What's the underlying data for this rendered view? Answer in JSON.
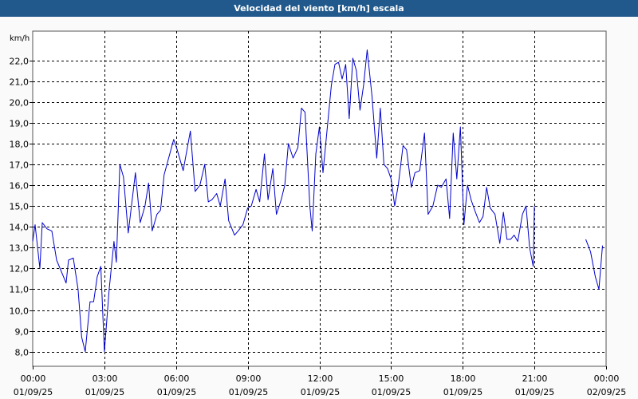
{
  "window": {
    "title": "Velocidad del viento [km/h] escala"
  },
  "colors": {
    "title_bar": "#21598c",
    "line": "#0000cc",
    "grid": "#000000",
    "background": "#fafafa"
  },
  "chart_data": {
    "type": "line",
    "title": "Velocidad del viento [km/h] escala",
    "ylabel": "km/h",
    "ylim": [
      7.3,
      23.4
    ],
    "yticks": [
      8.0,
      9.0,
      10.0,
      11.0,
      12.0,
      13.0,
      14.0,
      15.0,
      16.0,
      17.0,
      18.0,
      19.0,
      20.0,
      21.0,
      22.0
    ],
    "ytick_labels": [
      "8,0",
      "9,0",
      "10,0",
      "11,0",
      "12,0",
      "13,0",
      "14,0",
      "15,0",
      "16,0",
      "17,0",
      "18,0",
      "19,0",
      "20,0",
      "21,0",
      "22,0"
    ],
    "xlim": [
      0,
      24
    ],
    "xticks": [
      {
        "time": "00:00",
        "date": "01/09/25"
      },
      {
        "time": "03:00",
        "date": "01/09/25"
      },
      {
        "time": "06:00",
        "date": "01/09/25"
      },
      {
        "time": "09:00",
        "date": "01/09/25"
      },
      {
        "time": "12:00",
        "date": "01/09/25"
      },
      {
        "time": "15:00",
        "date": "01/09/25"
      },
      {
        "time": "18:00",
        "date": "01/09/25"
      },
      {
        "time": "21:00",
        "date": "01/09/25"
      },
      {
        "time": "00:00",
        "date": "02/09/25"
      }
    ],
    "grid": true,
    "grid_style": "dashed",
    "series": [
      {
        "color": "#0000cc",
        "segments": [
          [
            [
              0.0,
              13.3
            ],
            [
              0.1,
              14.1
            ],
            [
              0.3,
              12.0
            ],
            [
              0.4,
              14.2
            ],
            [
              0.6,
              13.9
            ],
            [
              0.8,
              13.8
            ],
            [
              1.0,
              12.4
            ],
            [
              1.4,
              11.3
            ],
            [
              1.5,
              12.4
            ],
            [
              1.7,
              12.5
            ],
            [
              1.9,
              11.0
            ],
            [
              2.05,
              8.7
            ],
            [
              2.2,
              8.0
            ],
            [
              2.4,
              10.4
            ],
            [
              2.55,
              10.4
            ],
            [
              2.7,
              11.6
            ],
            [
              2.85,
              12.1
            ],
            [
              3.0,
              8.0
            ],
            [
              3.2,
              11.0
            ],
            [
              3.4,
              13.3
            ],
            [
              3.5,
              12.3
            ],
            [
              3.65,
              17.0
            ],
            [
              3.8,
              16.4
            ],
            [
              4.0,
              13.7
            ],
            [
              4.3,
              16.6
            ],
            [
              4.5,
              14.2
            ],
            [
              4.7,
              15.0
            ],
            [
              4.85,
              16.1
            ],
            [
              5.0,
              13.8
            ],
            [
              5.2,
              14.6
            ],
            [
              5.35,
              14.8
            ],
            [
              5.5,
              16.5
            ],
            [
              5.9,
              18.2
            ],
            [
              6.05,
              17.7
            ],
            [
              6.3,
              16.7
            ],
            [
              6.6,
              18.6
            ],
            [
              6.8,
              15.7
            ],
            [
              7.0,
              16.0
            ],
            [
              7.2,
              17.0
            ],
            [
              7.35,
              15.2
            ],
            [
              7.5,
              15.3
            ],
            [
              7.7,
              15.6
            ],
            [
              7.85,
              15.0
            ],
            [
              8.05,
              16.3
            ],
            [
              8.2,
              14.3
            ],
            [
              8.45,
              13.6
            ],
            [
              8.6,
              13.8
            ],
            [
              8.8,
              14.1
            ],
            [
              9.0,
              14.9
            ],
            [
              9.15,
              15.0
            ],
            [
              9.35,
              15.8
            ],
            [
              9.5,
              15.2
            ],
            [
              9.7,
              17.5
            ],
            [
              9.85,
              15.3
            ],
            [
              10.05,
              16.8
            ],
            [
              10.2,
              14.6
            ],
            [
              10.4,
              15.3
            ],
            [
              10.55,
              16.0
            ],
            [
              10.7,
              18.0
            ],
            [
              10.9,
              17.3
            ],
            [
              11.1,
              17.8
            ],
            [
              11.25,
              19.7
            ],
            [
              11.4,
              19.5
            ],
            [
              11.6,
              15.0
            ],
            [
              11.7,
              13.8
            ],
            [
              11.85,
              17.5
            ],
            [
              12.0,
              18.8
            ],
            [
              12.15,
              16.6
            ],
            [
              12.3,
              18.4
            ],
            [
              12.5,
              20.8
            ],
            [
              12.65,
              21.8
            ],
            [
              12.8,
              21.9
            ],
            [
              12.95,
              21.1
            ],
            [
              13.1,
              21.8
            ],
            [
              13.25,
              19.2
            ],
            [
              13.4,
              22.1
            ],
            [
              13.55,
              21.5
            ],
            [
              13.7,
              19.6
            ],
            [
              13.85,
              20.8
            ],
            [
              14.0,
              22.5
            ],
            [
              14.2,
              20.3
            ],
            [
              14.4,
              17.3
            ],
            [
              14.55,
              19.7
            ],
            [
              14.7,
              17.0
            ],
            [
              14.85,
              16.8
            ],
            [
              15.0,
              16.3
            ],
            [
              15.15,
              15.0
            ],
            [
              15.3,
              16.0
            ],
            [
              15.5,
              17.9
            ],
            [
              15.65,
              17.7
            ],
            [
              15.85,
              15.9
            ],
            [
              16.0,
              16.6
            ],
            [
              16.2,
              16.7
            ],
            [
              16.4,
              18.5
            ],
            [
              16.55,
              14.6
            ],
            [
              16.75,
              15.0
            ],
            [
              16.95,
              16.0
            ],
            [
              17.1,
              15.9
            ],
            [
              17.3,
              16.3
            ],
            [
              17.45,
              14.4
            ],
            [
              17.6,
              18.5
            ],
            [
              17.75,
              16.3
            ],
            [
              17.9,
              18.8
            ],
            [
              18.05,
              14.1
            ],
            [
              18.2,
              16.0
            ],
            [
              18.35,
              15.3
            ],
            [
              18.5,
              14.8
            ],
            [
              18.7,
              14.2
            ],
            [
              18.85,
              14.5
            ],
            [
              19.0,
              15.9
            ],
            [
              19.15,
              14.9
            ],
            [
              19.35,
              14.6
            ],
            [
              19.55,
              13.2
            ],
            [
              19.7,
              14.7
            ],
            [
              19.85,
              13.4
            ],
            [
              20.0,
              13.4
            ],
            [
              20.15,
              13.6
            ],
            [
              20.3,
              13.3
            ],
            [
              20.5,
              14.6
            ],
            [
              20.65,
              15.0
            ],
            [
              20.8,
              13.0
            ],
            [
              20.95,
              12.1
            ],
            [
              21.0,
              15.0
            ]
          ],
          [
            [
              23.15,
              13.4
            ],
            [
              23.35,
              12.8
            ],
            [
              23.55,
              11.6
            ],
            [
              23.7,
              11.0
            ],
            [
              23.85,
              13.1
            ]
          ]
        ]
      }
    ]
  }
}
